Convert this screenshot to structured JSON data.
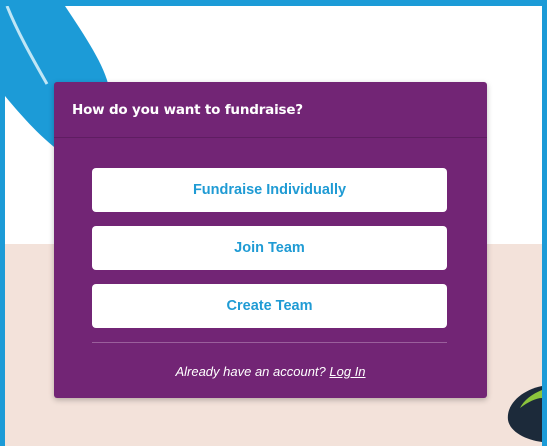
{
  "modal": {
    "title": "How do you want to fundraise?",
    "options": [
      {
        "label": "Fundraise Individually"
      },
      {
        "label": "Join Team"
      },
      {
        "label": "Create Team"
      }
    ],
    "footer_text": "Already have an account?",
    "login_label": "Log In"
  },
  "colors": {
    "modal_bg": "#722575",
    "button_text": "#1f9bd4",
    "page_border": "#1c9bd7",
    "accent_leaf": "#1c9bd7",
    "band": "#f3e2da"
  }
}
